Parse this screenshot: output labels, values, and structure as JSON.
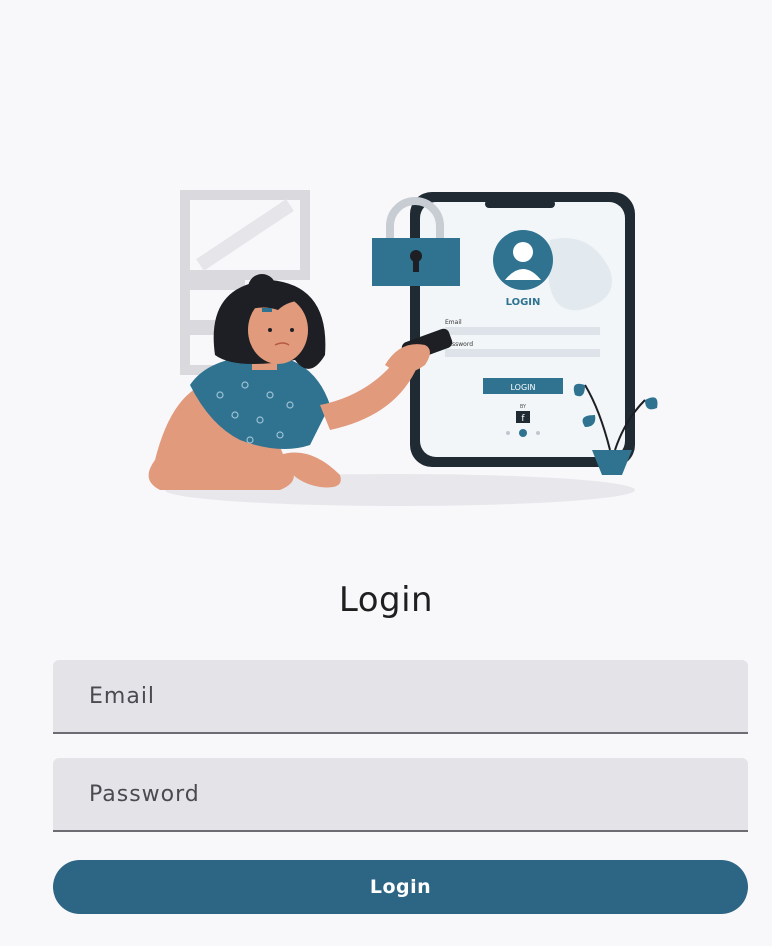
{
  "page": {
    "title": "Login"
  },
  "form": {
    "email_placeholder": "Email",
    "password_placeholder": "Password",
    "submit_label": "Login"
  },
  "illustration": {
    "phone_login_text": "LOGIN",
    "phone_button_text": "LOGIN",
    "phone_email_label": "Email",
    "phone_password_label": "Password",
    "phone_by_text": "BY",
    "phone_social_letter": "f"
  },
  "colors": {
    "primary": "#2d6585",
    "accent": "#2f7391",
    "background": "#f8f8fb",
    "field_bg": "#e3e3e8",
    "skin": "#e29a7c",
    "hair": "#1d1f24"
  }
}
